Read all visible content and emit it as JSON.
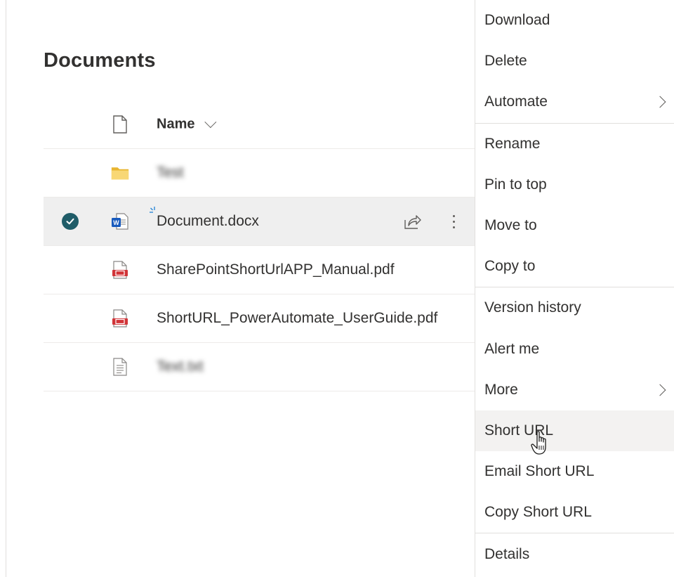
{
  "page": {
    "title": "Documents"
  },
  "list": {
    "header": {
      "name_label": "Name"
    },
    "rows": [
      {
        "name": "Test",
        "type": "folder-icon",
        "blurred": true
      },
      {
        "name": "Document.docx",
        "type": "word-document-icon",
        "selected": true
      },
      {
        "name": "SharePointShortUrlAPP_Manual.pdf",
        "type": "pdf-icon"
      },
      {
        "name": "ShortURL_PowerAutomate_UserGuide.pdf",
        "type": "pdf-icon"
      },
      {
        "name": "Text.txt",
        "type": "text-file-icon",
        "blurred": true
      }
    ]
  },
  "context_menu": {
    "groups": [
      [
        {
          "label": "Download"
        },
        {
          "label": "Delete"
        },
        {
          "label": "Automate",
          "submenu": true
        }
      ],
      [
        {
          "label": "Rename"
        },
        {
          "label": "Pin to top"
        },
        {
          "label": "Move to"
        },
        {
          "label": "Copy to"
        }
      ],
      [
        {
          "label": "Version history"
        },
        {
          "label": "Alert me"
        },
        {
          "label": "More",
          "submenu": true
        },
        {
          "label": "Short URL",
          "hovered": true
        },
        {
          "label": "Email Short URL"
        },
        {
          "label": "Copy Short URL"
        }
      ],
      [
        {
          "label": "Details"
        }
      ]
    ]
  },
  "colors": {
    "selected_row_bg": "#efefef",
    "check_circle": "#1f5c68",
    "folder": "#f8d775",
    "word_blue": "#185abd",
    "pdf_red": "#d13438",
    "menu_hover_bg": "#f3f2f1"
  }
}
